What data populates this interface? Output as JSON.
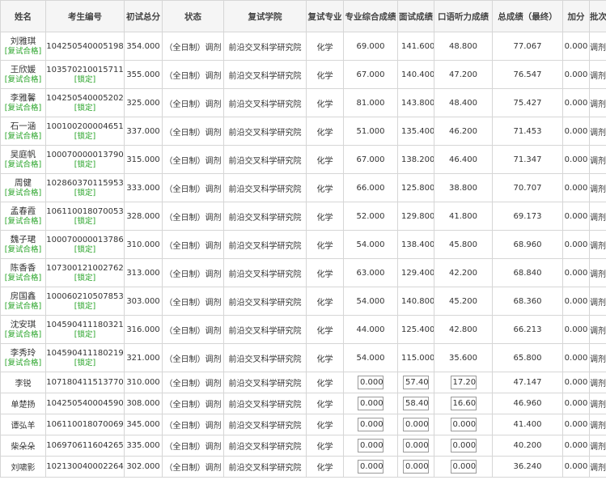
{
  "headers": [
    "姓名",
    "考生编号",
    "初试总分",
    "状态",
    "复试学院",
    "复试专业",
    "专业综合成绩",
    "面试成绩",
    "口语听力成绩",
    "总成绩（最终）",
    "加分",
    "批次"
  ],
  "rows": [
    {
      "name": "刘雅琪",
      "tag": "[复试合格]",
      "exam_id": "104250540005198",
      "exam_tag": "",
      "score": "354.000",
      "status": "（全日制）调剂",
      "college": "前沿交叉科学研究院",
      "major": "化学",
      "composite": "69.000",
      "interview": "141.600",
      "oral": "48.800",
      "total": "77.067",
      "bonus": "0.000",
      "batch": "调剂"
    },
    {
      "name": "王欣媛",
      "tag": "[复试合格]",
      "exam_id": "103570210015711",
      "exam_tag": "[锁定]",
      "score": "355.000",
      "status": "（全日制）调剂",
      "college": "前沿交叉科学研究院",
      "major": "化学",
      "composite": "67.000",
      "interview": "140.400",
      "oral": "47.200",
      "total": "76.547",
      "bonus": "0.000",
      "batch": "调剂"
    },
    {
      "name": "李雅馨",
      "tag": "[复试合格]",
      "exam_id": "104250540005202",
      "exam_tag": "[锁定]",
      "score": "325.000",
      "status": "（全日制）调剂",
      "college": "前沿交叉科学研究院",
      "major": "化学",
      "composite": "81.000",
      "interview": "143.800",
      "oral": "48.400",
      "total": "75.427",
      "bonus": "0.000",
      "batch": "调剂"
    },
    {
      "name": "石一涵",
      "tag": "[复试合格]",
      "exam_id": "100100200004651",
      "exam_tag": "[锁定]",
      "score": "337.000",
      "status": "（全日制）调剂",
      "college": "前沿交叉科学研究院",
      "major": "化学",
      "composite": "51.000",
      "interview": "135.400",
      "oral": "46.200",
      "total": "71.453",
      "bonus": "0.000",
      "batch": "调剂"
    },
    {
      "name": "吴庭帆",
      "tag": "[复试合格]",
      "exam_id": "100070000013790",
      "exam_tag": "[锁定]",
      "score": "315.000",
      "status": "（全日制）调剂",
      "college": "前沿交叉科学研究院",
      "major": "化学",
      "composite": "67.000",
      "interview": "138.200",
      "oral": "46.400",
      "total": "71.347",
      "bonus": "0.000",
      "batch": "调剂"
    },
    {
      "name": "周健",
      "tag": "[复试合格]",
      "exam_id": "102860370115953",
      "exam_tag": "[锁定]",
      "score": "333.000",
      "status": "（全日制）调剂",
      "college": "前沿交叉科学研究院",
      "major": "化学",
      "composite": "66.000",
      "interview": "125.800",
      "oral": "38.800",
      "total": "70.707",
      "bonus": "0.000",
      "batch": "调剂"
    },
    {
      "name": "孟春霞",
      "tag": "[复试合格]",
      "exam_id": "106110018070053",
      "exam_tag": "[锁定]",
      "score": "328.000",
      "status": "（全日制）调剂",
      "college": "前沿交叉科学研究院",
      "major": "化学",
      "composite": "52.000",
      "interview": "129.800",
      "oral": "41.800",
      "total": "69.173",
      "bonus": "0.000",
      "batch": "调剂"
    },
    {
      "name": "魏子珺",
      "tag": "[复试合格]",
      "exam_id": "100070000013786",
      "exam_tag": "[锁定]",
      "score": "310.000",
      "status": "（全日制）调剂",
      "college": "前沿交叉科学研究院",
      "major": "化学",
      "composite": "54.000",
      "interview": "138.400",
      "oral": "45.800",
      "total": "68.960",
      "bonus": "0.000",
      "batch": "调剂"
    },
    {
      "name": "陈香香",
      "tag": "[复试合格]",
      "exam_id": "107300121002762",
      "exam_tag": "[锁定]",
      "score": "313.000",
      "status": "（全日制）调剂",
      "college": "前沿交叉科学研究院",
      "major": "化学",
      "composite": "63.000",
      "interview": "129.400",
      "oral": "42.200",
      "total": "68.840",
      "bonus": "0.000",
      "batch": "调剂"
    },
    {
      "name": "房国鑫",
      "tag": "[复试合格]",
      "exam_id": "100060210507853",
      "exam_tag": "[锁定]",
      "score": "303.000",
      "status": "（全日制）调剂",
      "college": "前沿交叉科学研究院",
      "major": "化学",
      "composite": "54.000",
      "interview": "140.800",
      "oral": "45.200",
      "total": "68.360",
      "bonus": "0.000",
      "batch": "调剂"
    },
    {
      "name": "沈安琪",
      "tag": "[复试合格]",
      "exam_id": "104590411180321",
      "exam_tag": "[锁定]",
      "score": "316.000",
      "status": "（全日制）调剂",
      "college": "前沿交叉科学研究院",
      "major": "化学",
      "composite": "44.000",
      "interview": "125.400",
      "oral": "42.800",
      "total": "66.213",
      "bonus": "0.000",
      "batch": "调剂"
    },
    {
      "name": "李秀玲",
      "tag": "[复试合格]",
      "exam_id": "104590411180219",
      "exam_tag": "[锁定]",
      "score": "321.000",
      "status": "（全日制）调剂",
      "college": "前沿交叉科学研究院",
      "major": "化学",
      "composite": "54.000",
      "interview": "115.000",
      "oral": "35.600",
      "total": "65.800",
      "bonus": "0.000",
      "batch": "调剂"
    }
  ],
  "input_rows": [
    {
      "name": "李锐",
      "exam_id": "107180411513770",
      "score": "310.000",
      "status": "（全日制）调剂",
      "college": "前沿交叉科学研究院",
      "major": "化学",
      "composite": "0.000",
      "interview": "57.400",
      "oral": "17.200",
      "total": "47.147",
      "bonus": "0.000",
      "batch": "调剂"
    },
    {
      "name": "单楚扬",
      "exam_id": "104250540004590",
      "score": "308.000",
      "status": "（全日制）调剂",
      "college": "前沿交叉科学研究院",
      "major": "化学",
      "composite": "0.000",
      "interview": "58.400",
      "oral": "16.600",
      "total": "46.960",
      "bonus": "0.000",
      "batch": "调剂"
    },
    {
      "name": "谭弘羊",
      "exam_id": "106110018070069",
      "score": "345.000",
      "status": "（全日制）调剂",
      "college": "前沿交叉科学研究院",
      "major": "化学",
      "composite": "0.000",
      "interview": "0.000",
      "oral": "0.000",
      "total": "41.400",
      "bonus": "0.000",
      "batch": "调剂"
    },
    {
      "name": "柴朵朵",
      "exam_id": "106970611604265",
      "score": "335.000",
      "status": "（全日制）调剂",
      "college": "前沿交叉科学研究院",
      "major": "化学",
      "composite": "0.000",
      "interview": "0.000",
      "oral": "0.000",
      "total": "40.200",
      "bonus": "0.000",
      "batch": "调剂"
    },
    {
      "name": "刘啸影",
      "exam_id": "102130040002264",
      "score": "302.000",
      "status": "（全日制）调剂",
      "college": "前沿交叉科学研究院",
      "major": "化学",
      "composite": "0.000",
      "interview": "0.000",
      "oral": "0.000",
      "total": "36.240",
      "bonus": "0.000",
      "batch": "调剂"
    }
  ]
}
